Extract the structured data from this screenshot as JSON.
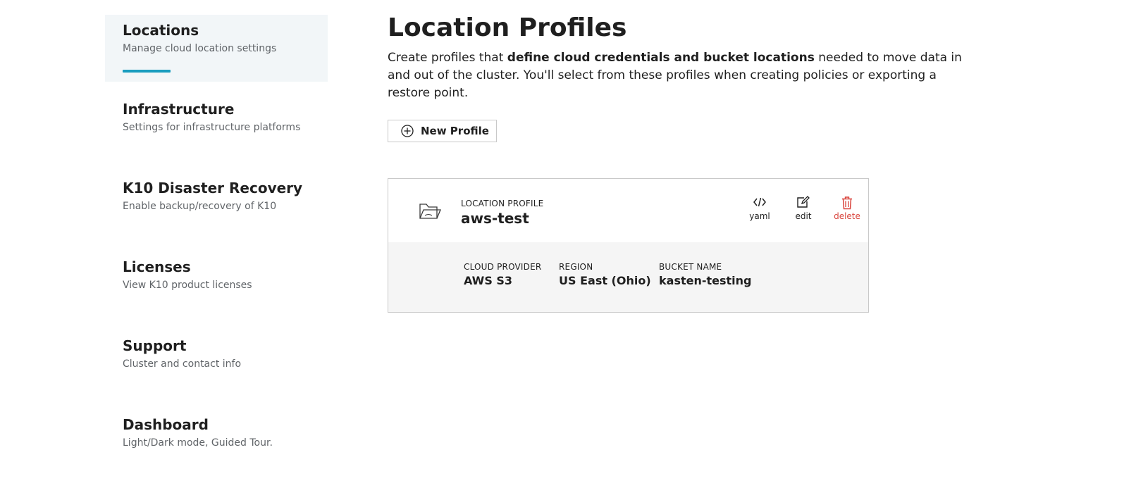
{
  "sidebar": {
    "items": [
      {
        "title": "Locations",
        "subtitle": "Manage cloud location settings",
        "active": true
      },
      {
        "title": "Infrastructure",
        "subtitle": "Settings for infrastructure platforms"
      },
      {
        "title": "K10 Disaster Recovery",
        "subtitle": "Enable backup/recovery of K10"
      },
      {
        "title": "Licenses",
        "subtitle": "View K10 product licenses"
      },
      {
        "title": "Support",
        "subtitle": "Cluster and contact info"
      },
      {
        "title": "Dashboard",
        "subtitle": "Light/Dark mode, Guided Tour."
      }
    ]
  },
  "main": {
    "title": "Location Profiles",
    "description": {
      "before": "Create profiles that ",
      "bold": "define cloud credentials and bucket locations",
      "after": " needed to move data in and out of the cluster. You'll select from these profiles when creating policies or exporting a restore point."
    },
    "new_profile_label": "New Profile"
  },
  "profile_card": {
    "kicker": "LOCATION PROFILE",
    "name": "aws-test",
    "actions": {
      "yaml": "yaml",
      "edit": "edit",
      "delete": "delete"
    },
    "fields": {
      "provider": {
        "label": "CLOUD PROVIDER",
        "value": "AWS S3"
      },
      "region": {
        "label": "REGION",
        "value": "US East (Ohio)"
      },
      "bucket": {
        "label": "BUCKET NAME",
        "value": "kasten-testing"
      }
    }
  },
  "colors": {
    "accent": "#1a9dbf",
    "active_bg": "#f2f6f8",
    "danger": "#d9453d"
  }
}
